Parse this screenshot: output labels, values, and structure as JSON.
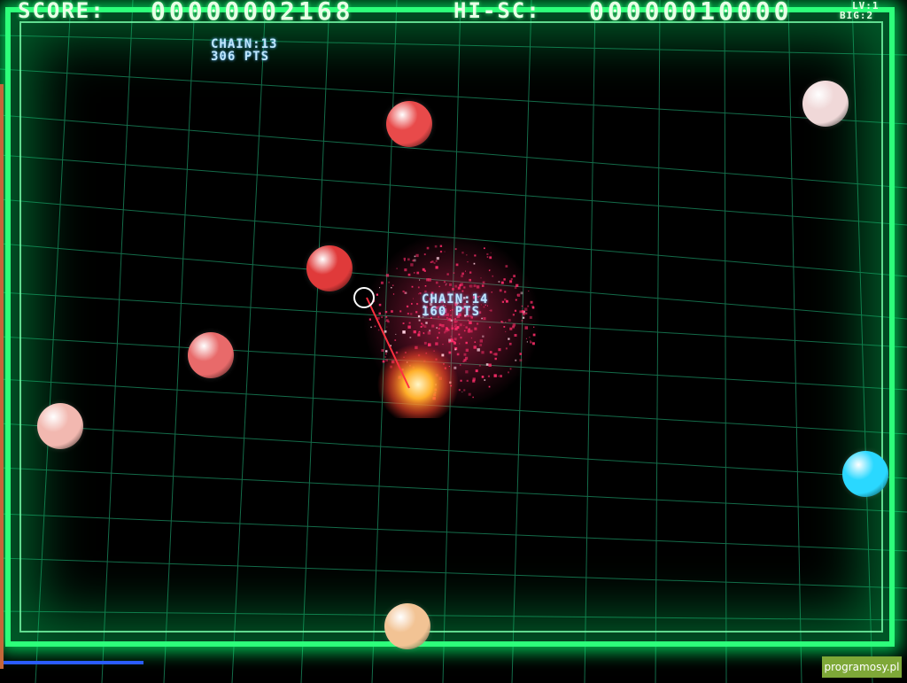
{
  "hud": {
    "score_label": "SCORE:",
    "score_value": "00000002168",
    "hiscore_label": "HI-SC:",
    "hiscore_value": "00000010000",
    "level": "LV:1",
    "big": "BIG:2"
  },
  "chains": [
    {
      "chain": "CHAIN:13",
      "points": "306 PTS"
    },
    {
      "chain": "CHAIN:14",
      "points": "160 PTS"
    }
  ],
  "balls": [
    {
      "name": "red-ball-top",
      "color": "#e84a4a"
    },
    {
      "name": "white-ball-topright",
      "color": "#f0d8d8"
    },
    {
      "name": "red-ball-center",
      "color": "#e03a3a"
    },
    {
      "name": "pink-ball-left",
      "color": "#e86a6a"
    },
    {
      "name": "peach-ball-leftedge",
      "color": "#f2b8b0"
    },
    {
      "name": "cyan-ball-right",
      "color": "#2ad8ff"
    },
    {
      "name": "tan-ball-bottom",
      "color": "#f2c394"
    }
  ],
  "watermark": "programosy.pl",
  "colors": {
    "frame": "#2dff7a",
    "grid": "#1e9c6a",
    "explosion": "#ff2d6a"
  }
}
